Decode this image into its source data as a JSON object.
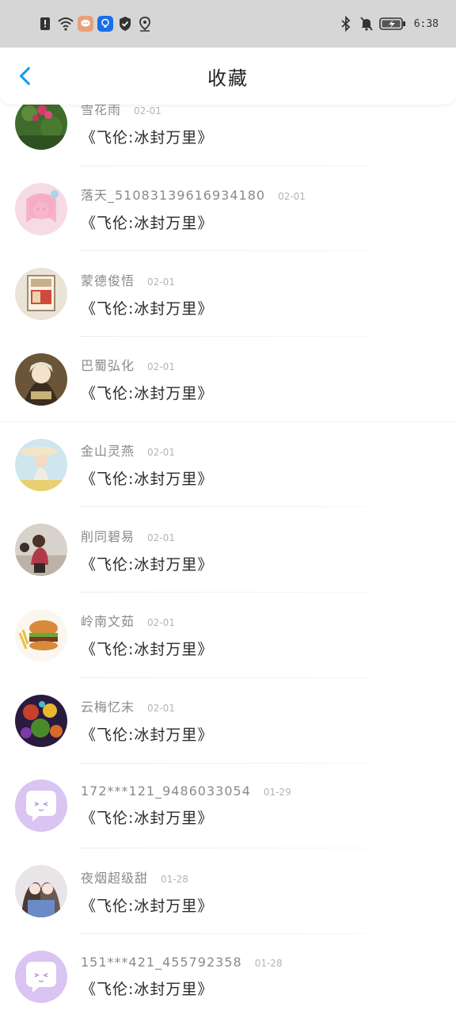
{
  "status_bar": {
    "time": "6:38",
    "left_icons": [
      "alert-icon",
      "wifi-icon",
      "message-app-icon",
      "bulb-app-icon",
      "shield-icon",
      "location-icon"
    ],
    "right_icons": [
      "bluetooth-icon",
      "mute-icon",
      "battery-icon"
    ]
  },
  "header": {
    "title": "收藏",
    "back_icon": "chevron-left-icon",
    "accent_color": "#1a9cf0"
  },
  "favorites": [
    {
      "username": "雪花雨",
      "date": "02-01",
      "title": "《飞伦:冰封万里》",
      "avatar": "flowers"
    },
    {
      "username": "落天_510831396169341​80",
      "date": "02-01",
      "title": "《飞伦:冰封万里》",
      "avatar": "anime-girl-pink"
    },
    {
      "username": "蒙德俊悟",
      "date": "02-01",
      "title": "《飞伦:冰封万里》",
      "avatar": "poster"
    },
    {
      "username": "巴蜀弘化",
      "date": "02-01",
      "title": "《飞伦:冰封万里》",
      "avatar": "anime-boy"
    },
    {
      "username": "金山灵燕",
      "date": "02-01",
      "title": "《飞伦:冰封万里》",
      "avatar": "girl-hat"
    },
    {
      "username": "削同碧易",
      "date": "02-01",
      "title": "《飞伦:冰封万里》",
      "avatar": "girl-beach"
    },
    {
      "username": "岭南文茹",
      "date": "02-01",
      "title": "《飞伦:冰封万里》",
      "avatar": "burger"
    },
    {
      "username": "云梅忆末",
      "date": "02-01",
      "title": "《飞伦:冰封万里》",
      "avatar": "colorful"
    },
    {
      "username": "172***121_9486033054",
      "date": "01-29",
      "title": "《飞伦:冰封万里》",
      "avatar": "default-chat"
    },
    {
      "username": "夜烟超级甜",
      "date": "01-28",
      "title": "《飞伦:冰封万里》",
      "avatar": "anime-couple"
    },
    {
      "username": "151***421_455792358",
      "date": "01-28",
      "title": "《飞伦:冰封万里》",
      "avatar": "default-chat"
    }
  ]
}
